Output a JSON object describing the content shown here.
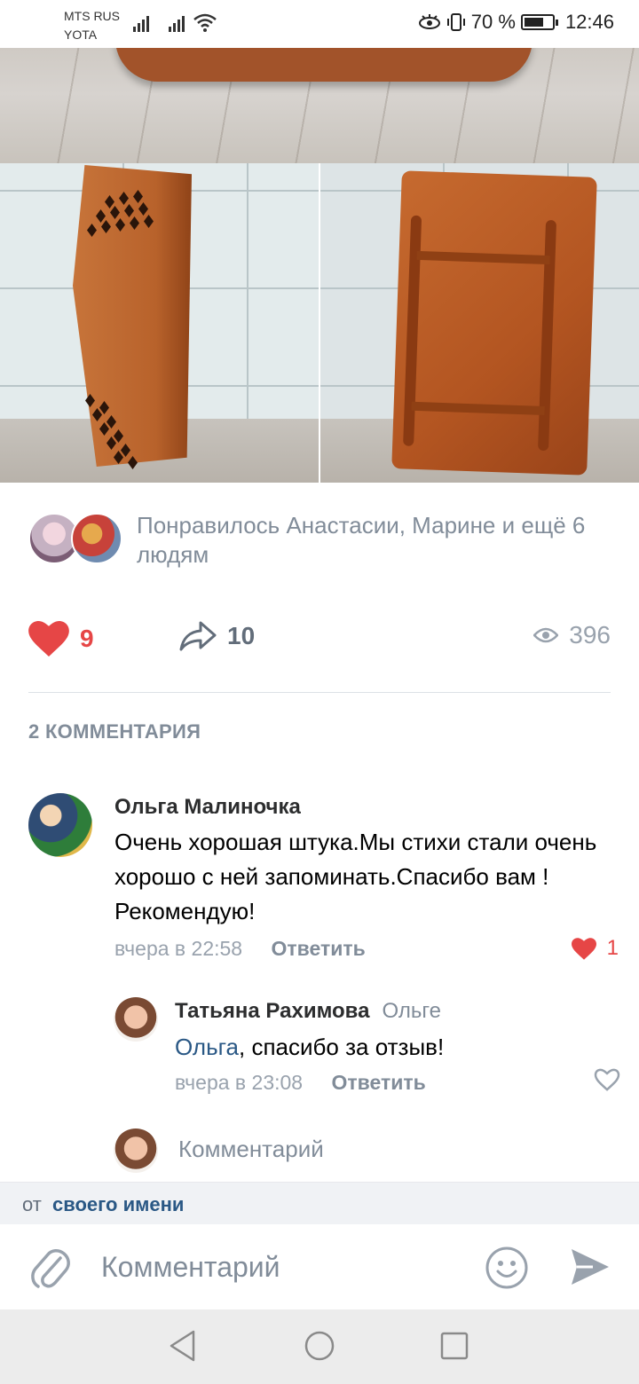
{
  "status_bar": {
    "carrier_1": "MTS RUS",
    "carrier_2": "YOTA",
    "battery_percent": "70 %",
    "battery_level": 0.7,
    "time": "12:46"
  },
  "post": {
    "photos": [
      "wooden-tray-photo",
      "wooden-board-diamond-holes-photo",
      "wooden-board-shelf-photo"
    ],
    "liked_by_text": "Понравилось Анастасии, Марине и ещё 6 людям",
    "likes_count": "9",
    "shares_count": "10",
    "views_count": "396"
  },
  "comments": {
    "header": "2 КОММЕНТАРИЯ",
    "items": [
      {
        "author": "Ольга Малиночка",
        "text": "Очень хорошая штука.Мы стихи стали очень хорошо с ней запоминать.Спасибо вам !Рекомендую!",
        "time": "вчера в 22:58",
        "reply_label": "Ответить",
        "likes": "1"
      },
      {
        "author": "Татьяна Рахимова",
        "reply_to": "Ольге",
        "mention": "Ольга",
        "text": ", спасибо за отзыв!",
        "time": "вчера в 23:08",
        "reply_label": "Ответить"
      }
    ],
    "own_placeholder": "Комментарий"
  },
  "from_bar": {
    "prefix": "от",
    "link": "своего имени"
  },
  "composer": {
    "placeholder": "Комментарий"
  },
  "colors": {
    "accent": "#2a5885",
    "like_red": "#e64646",
    "secondary_text": "#818c99"
  }
}
